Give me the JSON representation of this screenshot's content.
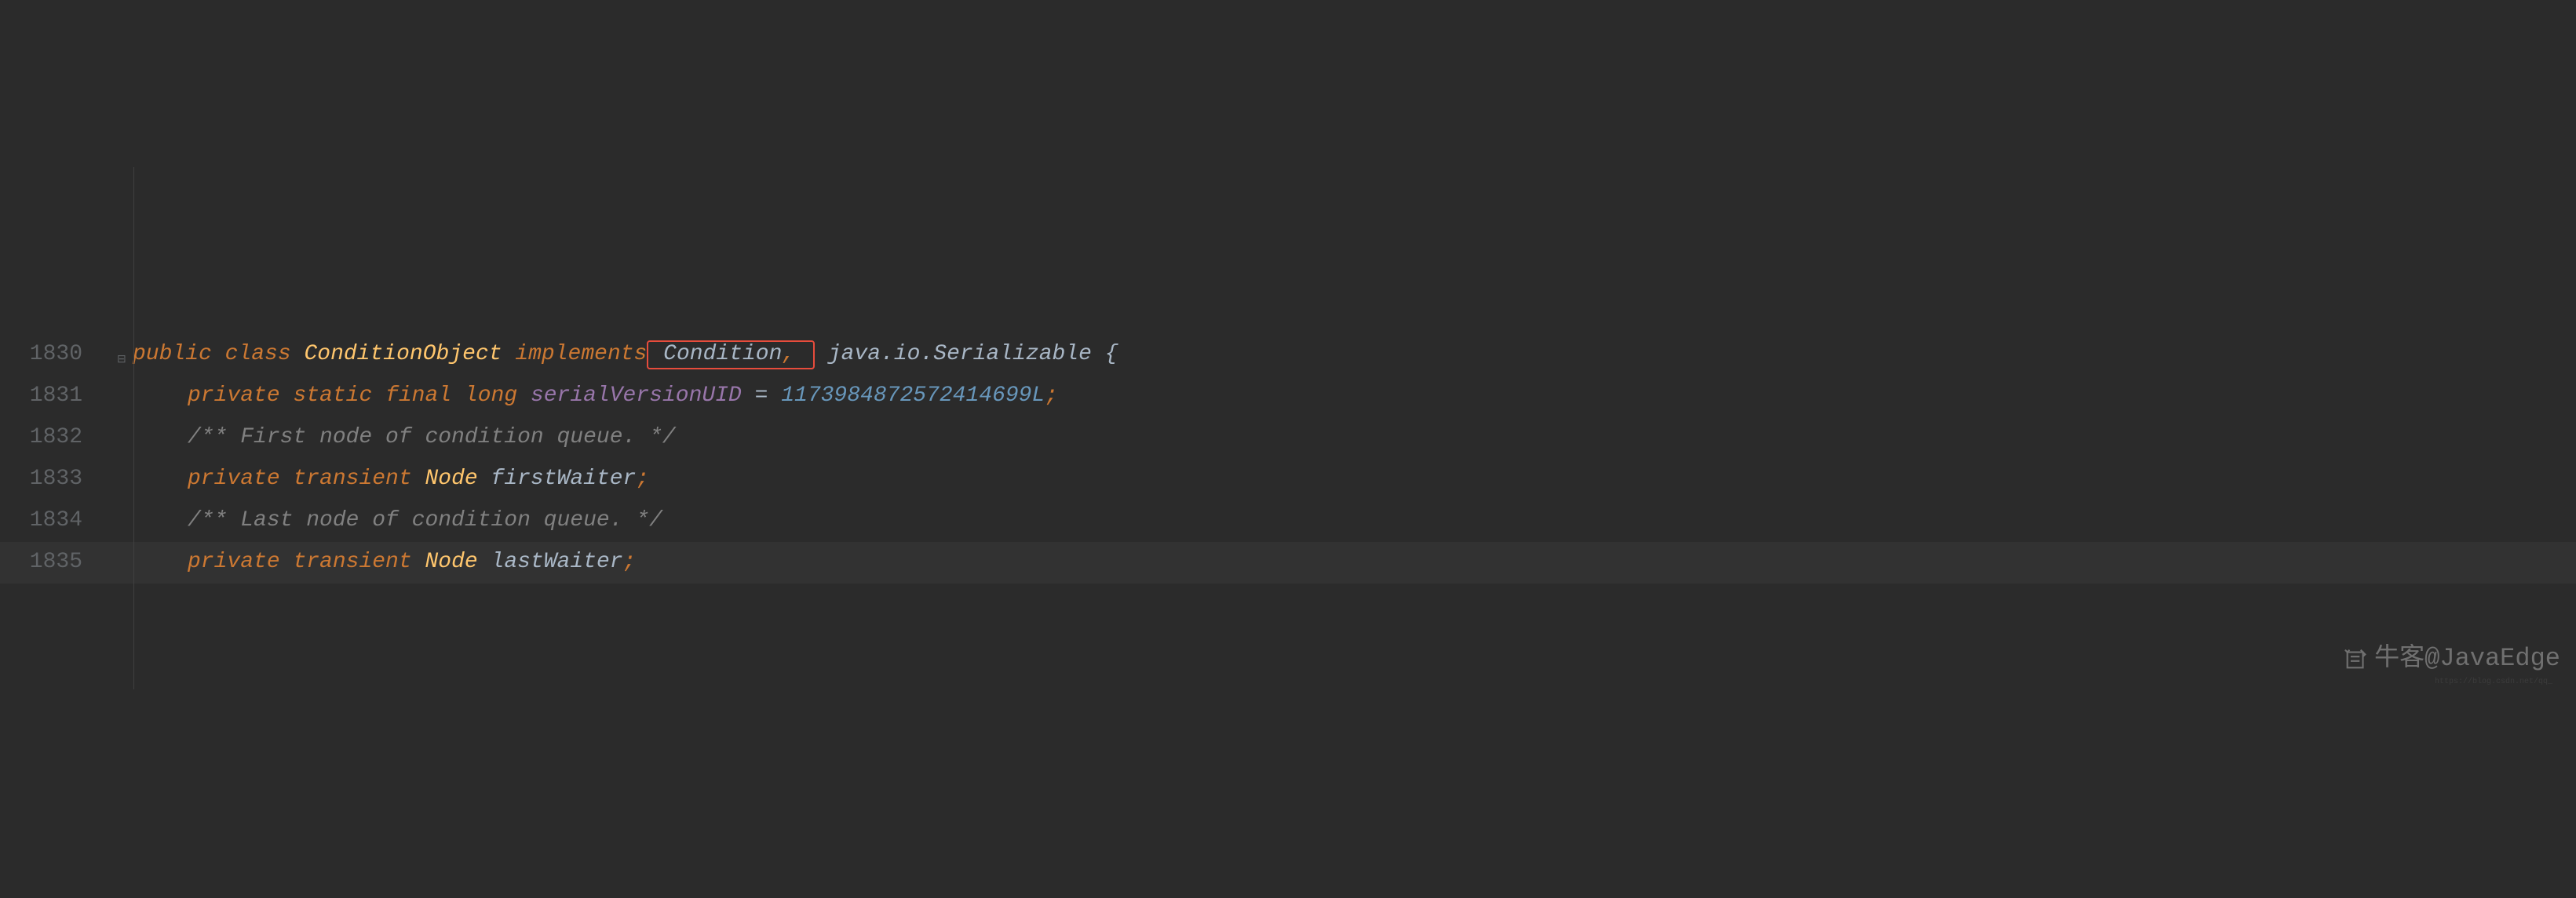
{
  "lines": {
    "l1830": {
      "num": "1830",
      "public": "public",
      "class": "class",
      "ConditionObject": "ConditionObject",
      "implements": "implements",
      "Condition": "Condition",
      "comma": ",",
      "javaio": "java.io.Serializable",
      "brace": "{"
    },
    "l1831": {
      "num": "1831",
      "private": "private",
      "static": "static",
      "final": "final",
      "long": "long",
      "serialVersionUID": "serialVersionUID",
      "eq": "=",
      "value": "1173984872572414699L",
      "semi": ";"
    },
    "l1832": {
      "num": "1832",
      "comment": "/** First node of condition queue. */"
    },
    "l1833": {
      "num": "1833",
      "private": "private",
      "transient": "transient",
      "Node": "Node",
      "firstWaiter": "firstWaiter",
      "semi": ";"
    },
    "l1834": {
      "num": "1834",
      "comment": "/** Last node of condition queue. */"
    },
    "l1835": {
      "num": "1835",
      "private": "private",
      "transient": "transient",
      "Node": "Node",
      "lastWaiter": "lastWaiter",
      "semi": ";"
    }
  },
  "watermark": {
    "text": "牛客@JavaEdge",
    "sub": "https://blog.csdn.net/qq_"
  }
}
